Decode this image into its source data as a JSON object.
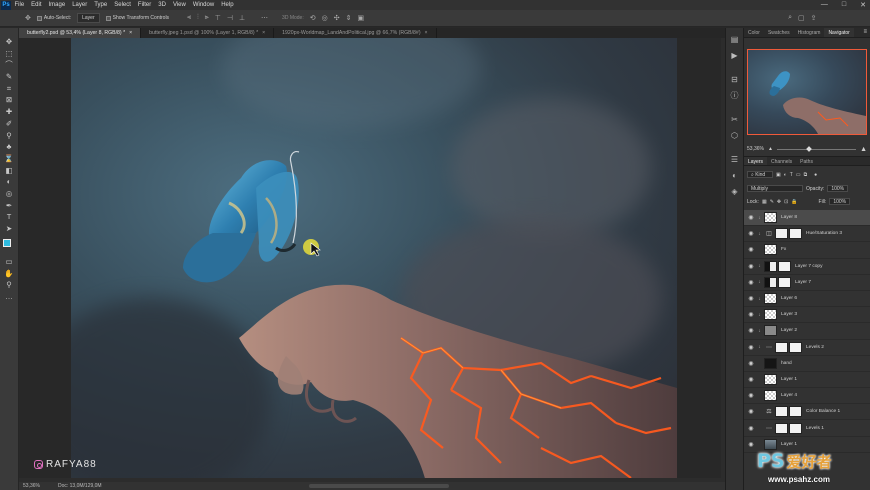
{
  "app": {
    "logo": "Ps"
  },
  "menu": [
    "File",
    "Edit",
    "Image",
    "Layer",
    "Type",
    "Select",
    "Filter",
    "3D",
    "View",
    "Window",
    "Help"
  ],
  "window_controls": [
    "—",
    "□",
    "✕"
  ],
  "options": {
    "auto_select_label": "Auto-Select:",
    "auto_select_value": "Layer",
    "transform_label": "Show Transform Controls",
    "mode_3d": "3D Mode:"
  },
  "tabs": [
    {
      "label": "butterfly2.psd @ 53,4% (Layer 8, RGB/8) *",
      "active": true
    },
    {
      "label": "butterfly.jpeg 1.psd @ 100% (Layer 1, RGB/8) *",
      "active": false
    },
    {
      "label": "1920px-Worldmap_LandAndPolitical.jpg @ 66,7% (RGB/8#)",
      "active": false
    }
  ],
  "tools": [
    "✥",
    "⬚",
    "⌒",
    "✎",
    "⌗",
    "⊠",
    "✚",
    "✐",
    "⚲",
    "♣",
    "⌛",
    "◧",
    "◐",
    "◎",
    "✒",
    "T",
    "➤",
    "▭",
    "✋",
    "⚲",
    "…"
  ],
  "canvas": {
    "watermark_text": "RAFYA88"
  },
  "status": {
    "zoom": "53,36%",
    "doc": "Doc: 13,0M/129,0M"
  },
  "panel": {
    "top_tabs": [
      "Color",
      "Swatches",
      "Histogram",
      "Navigator"
    ],
    "zoom_value": "53,36%",
    "layer_tabs": [
      "Layers",
      "Channels",
      "Paths"
    ],
    "filter_kind": "Kind",
    "blend_mode": "Multiply",
    "opacity_label": "Opacity:",
    "opacity_value": "100%",
    "lock_label": "Lock:",
    "fill_label": "Fill:",
    "fill_value": "100%"
  },
  "layers": [
    {
      "name": "Layer 8",
      "thumb": "checker",
      "selected": true,
      "clip": "↓",
      "adj": ""
    },
    {
      "name": "Hue/Saturation 3",
      "thumb": "white",
      "selected": false,
      "clip": "↓",
      "adj": "◫"
    },
    {
      "name": "Fx",
      "thumb": "checker",
      "selected": false,
      "clip": "",
      "adj": ""
    },
    {
      "name": "Layer 7 copy",
      "thumb": "maskbw",
      "selected": false,
      "clip": "↓",
      "adj": ""
    },
    {
      "name": "Layer 7",
      "thumb": "maskbw",
      "selected": false,
      "clip": "↓",
      "adj": ""
    },
    {
      "name": "Layer 6",
      "thumb": "checker",
      "selected": false,
      "clip": "↓",
      "adj": ""
    },
    {
      "name": "Layer 3",
      "thumb": "checker",
      "selected": false,
      "clip": "↓",
      "adj": ""
    },
    {
      "name": "Layer 2",
      "thumb": "gray",
      "selected": false,
      "clip": "↓",
      "adj": ""
    },
    {
      "name": "Levels 2",
      "thumb": "white",
      "selected": false,
      "clip": "↓",
      "adj": "⋯"
    },
    {
      "name": "hand",
      "thumb": "black",
      "selected": false,
      "clip": "",
      "adj": ""
    },
    {
      "name": "Layer 1",
      "thumb": "checker",
      "selected": false,
      "clip": "",
      "adj": ""
    },
    {
      "name": "Layer 4",
      "thumb": "checker",
      "selected": false,
      "clip": "",
      "adj": ""
    },
    {
      "name": "Color Balance 1",
      "thumb": "white",
      "selected": false,
      "clip": "",
      "adj": "⚖"
    },
    {
      "name": "Levels 1",
      "thumb": "white",
      "selected": false,
      "clip": "",
      "adj": "⋯"
    },
    {
      "name": "Layer 1",
      "thumb": "sky",
      "selected": false,
      "clip": "",
      "adj": ""
    }
  ],
  "site_watermark": {
    "ps": "PS",
    "cn": "爱好者",
    "url": "www.psahz.com"
  }
}
